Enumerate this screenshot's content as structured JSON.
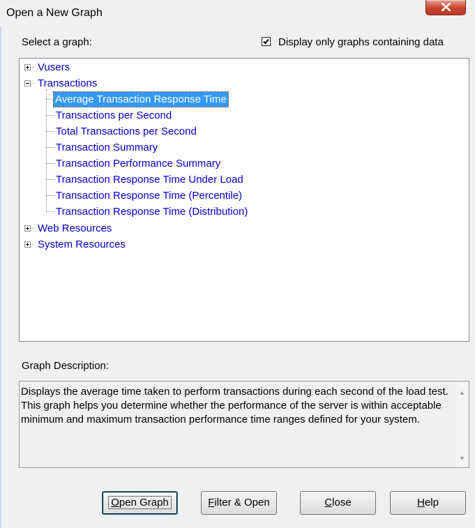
{
  "window": {
    "title": "Open a New Graph",
    "close_icon": "close-x-icon"
  },
  "select_label": "Select a graph:",
  "display_only_checkbox": {
    "label": "Display only graphs containing data",
    "checked": true
  },
  "tree": {
    "vusers": "Vusers",
    "transactions": "Transactions",
    "children": [
      "Average Transaction Response Time",
      "Transactions per Second",
      "Total Transactions per Second",
      "Transaction Summary",
      "Transaction Performance Summary",
      "Transaction Response Time Under Load",
      "Transaction Response Time (Percentile)",
      "Transaction Response Time (Distribution)"
    ],
    "selected_index": 0,
    "web_resources": "Web Resources",
    "system_resources": "System Resources"
  },
  "description_label": "Graph Description:",
  "description_text": "Displays the average time taken to perform transactions during each second of the load test. This graph helps you determine whether the performance of the server is within acceptable minimum and maximum transaction performance time ranges defined for your system.",
  "buttons": {
    "open_graph": {
      "mnemonic": "O",
      "rest": "pen Graph"
    },
    "filter_open": {
      "mnemonic": "F",
      "rest": "ilter & Open"
    },
    "close": {
      "mnemonic": "C",
      "rest": "lose"
    },
    "help": {
      "mnemonic": "H",
      "rest": "elp"
    }
  }
}
